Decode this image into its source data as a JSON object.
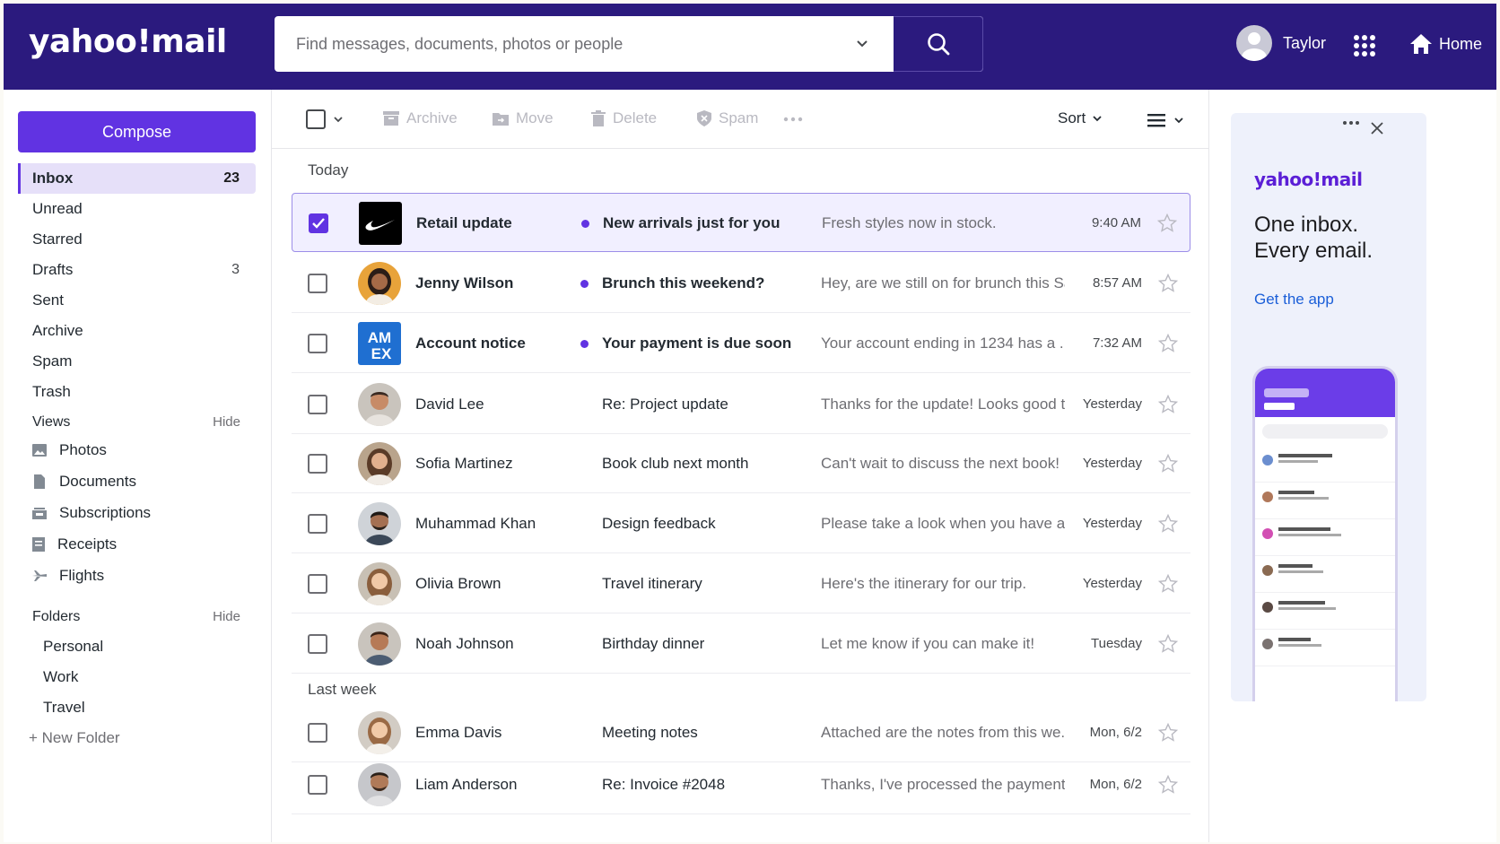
{
  "header": {
    "logo": "yahoo!mail",
    "search_placeholder": "Find messages, documents, photos or people",
    "user_name": "Taylor",
    "home_label": "Home"
  },
  "sidebar": {
    "compose_label": "Compose",
    "mailboxes": [
      {
        "label": "Inbox",
        "count": "23",
        "active": true
      },
      {
        "label": "Unread",
        "count": ""
      },
      {
        "label": "Starred",
        "count": ""
      },
      {
        "label": "Drafts",
        "count": "3"
      },
      {
        "label": "Sent",
        "count": ""
      },
      {
        "label": "Archive",
        "count": ""
      },
      {
        "label": "Spam",
        "count": ""
      },
      {
        "label": "Trash",
        "count": ""
      }
    ],
    "views_title": "Views",
    "views_hide": "Hide",
    "views": [
      {
        "label": "Photos",
        "icon": "photo-icon"
      },
      {
        "label": "Documents",
        "icon": "document-icon"
      },
      {
        "label": "Subscriptions",
        "icon": "subscriptions-icon"
      },
      {
        "label": "Receipts",
        "icon": "receipt-icon"
      },
      {
        "label": "Flights",
        "icon": "plane-icon"
      }
    ],
    "folders_title": "Folders",
    "folders_hide": "Hide",
    "folders": [
      "Personal",
      "Work",
      "Travel"
    ],
    "new_folder": "+ New Folder"
  },
  "toolbar": {
    "archive": "Archive",
    "move": "Move",
    "delete": "Delete",
    "spam": "Spam",
    "sort": "Sort"
  },
  "groups": {
    "today": "Today",
    "last_week": "Last week"
  },
  "messages": [
    {
      "sender": "Retail update",
      "subject": "New arrivals just for you",
      "preview": "Fresh styles now in stock.",
      "time": "9:40 AM",
      "unread": true,
      "selected": true,
      "avatar": "swoosh-logo"
    },
    {
      "sender": "Jenny Wilson",
      "subject": "Brunch this weekend?",
      "preview": "Hey, are we still on for brunch this Sa...",
      "time": "8:57 AM",
      "unread": true,
      "avatar": "person"
    },
    {
      "sender": "Account notice",
      "subject": "Your payment is due soon",
      "preview": "Your account ending in 1234 has a ...",
      "time": "7:32 AM",
      "unread": true,
      "avatar": "amex-logo"
    },
    {
      "sender": "David Lee",
      "subject": "Re: Project update",
      "preview": "Thanks for the update! Looks good t...",
      "time": "Yesterday",
      "avatar": "person"
    },
    {
      "sender": "Sofia Martinez",
      "subject": "Book club next month",
      "preview": "Can't wait to discuss the next book!",
      "time": "Yesterday",
      "avatar": "person"
    },
    {
      "sender": "Muhammad Khan",
      "subject": "Design feedback",
      "preview": "Please take a look when you have a ...",
      "time": "Yesterday",
      "avatar": "person"
    },
    {
      "sender": "Olivia Brown",
      "subject": "Travel itinerary",
      "preview": "Here's the itinerary for our trip.",
      "time": "Yesterday",
      "avatar": "person"
    },
    {
      "sender": "Noah Johnson",
      "subject": "Birthday dinner",
      "preview": "Let me know if you can make it!",
      "time": "Tuesday",
      "avatar": "person"
    },
    {
      "sender": "Emma Davis",
      "subject": "Meeting notes",
      "preview": "Attached are the notes from this we...",
      "time": "Mon, 6/2",
      "avatar": "person"
    },
    {
      "sender": "Liam Anderson",
      "subject": "Re: Invoice #2048",
      "preview": "Thanks, I've processed the payment.",
      "time": "Mon, 6/2",
      "avatar": "person"
    }
  ],
  "ad": {
    "logo": "yahoo!mail",
    "headline": "One inbox. Every email.",
    "cta": "Get the app"
  },
  "colors": {
    "brand": "#2b1a7e",
    "accent": "#6133e2",
    "link": "#1b5fd8"
  }
}
